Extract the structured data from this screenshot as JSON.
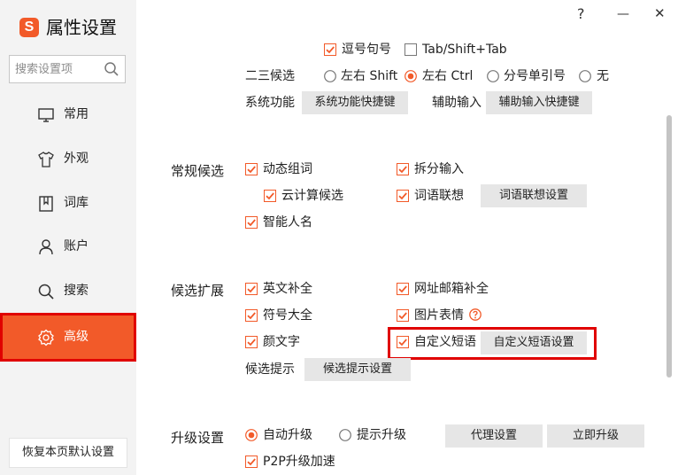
{
  "app": {
    "title": "属性设置"
  },
  "window": {
    "help": "?",
    "minimize": "—",
    "close": "✕"
  },
  "search": {
    "placeholder": "搜索设置项"
  },
  "sidebar": {
    "items": [
      {
        "label": "常用",
        "icon": "monitor-icon"
      },
      {
        "label": "外观",
        "icon": "shirt-icon"
      },
      {
        "label": "词库",
        "icon": "book-icon"
      },
      {
        "label": "账户",
        "icon": "user-icon"
      },
      {
        "label": "搜索",
        "icon": "search-icon"
      },
      {
        "label": "高级",
        "icon": "gear-icon",
        "active": true
      }
    ],
    "restore_label": "恢复本页默认设置"
  },
  "top": {
    "comma_period": "逗号句号",
    "tab_shift": "Tab/Shift+Tab",
    "second_third_label": "二三候选",
    "radio_options": [
      "左右 Shift",
      "左右 Ctrl",
      "分号单引号",
      "无"
    ],
    "selected_radio": "左右 Ctrl",
    "system_func_label": "系统功能",
    "system_func_button": "系统功能快捷键",
    "assist_input_label": "辅助输入",
    "assist_input_button": "辅助输入快捷键"
  },
  "regular": {
    "section": "常规候选",
    "dynamic_phrase": "动态组词",
    "split_input": "拆分输入",
    "cloud_candidates": "云计算候选",
    "word_association": "词语联想",
    "word_association_button": "词语联想设置",
    "smart_names": "智能人名"
  },
  "extension": {
    "section": "候选扩展",
    "english_complete": "英文补全",
    "url_email_complete": "网址邮箱补全",
    "symbols": "符号大全",
    "image_emoji": "图片表情",
    "kaomoji": "颜文字",
    "custom_phrase": "自定义短语",
    "custom_phrase_button": "自定义短语设置",
    "hint_label": "候选提示",
    "hint_button": "候选提示设置"
  },
  "upgrade": {
    "section": "升级设置",
    "auto_upgrade": "自动升级",
    "prompt_upgrade": "提示升级",
    "proxy_button": "代理设置",
    "upgrade_now_button": "立即升级",
    "p2p": "P2P升级加速"
  },
  "colors": {
    "accent": "#f25a29",
    "highlight": "#e00000"
  }
}
